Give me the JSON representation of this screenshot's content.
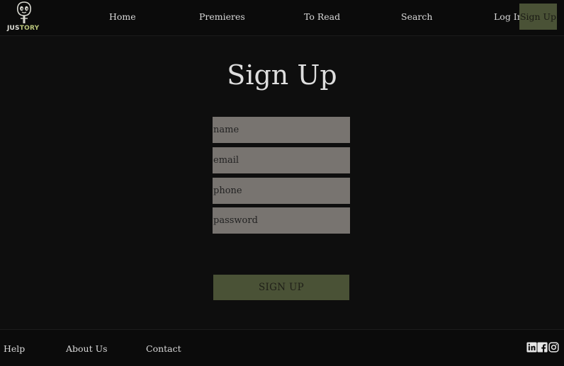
{
  "header": {
    "logo_text_a": "JUS",
    "logo_text_b": "TORY",
    "nav": {
      "home": "Home",
      "premieres": "Premieres",
      "to_read": "To Read",
      "search": "Search",
      "log_in": "Log In",
      "sign_up": "Sign Up"
    }
  },
  "main": {
    "title": "Sign Up",
    "fields": {
      "name_placeholder": "name",
      "email_placeholder": "email",
      "phone_placeholder": "phone",
      "password_placeholder": "password"
    },
    "submit_label": "SIGN UP"
  },
  "footer": {
    "help": "Help",
    "about": "About Us",
    "contact": "Contact",
    "social_icons": [
      "linkedin-icon",
      "facebook-icon",
      "instagram-icon"
    ]
  },
  "colors": {
    "background": "#0e0e0e",
    "accent_olive": "#4a5236",
    "field_gray": "#787470",
    "text_light": "#d9d9d9"
  }
}
